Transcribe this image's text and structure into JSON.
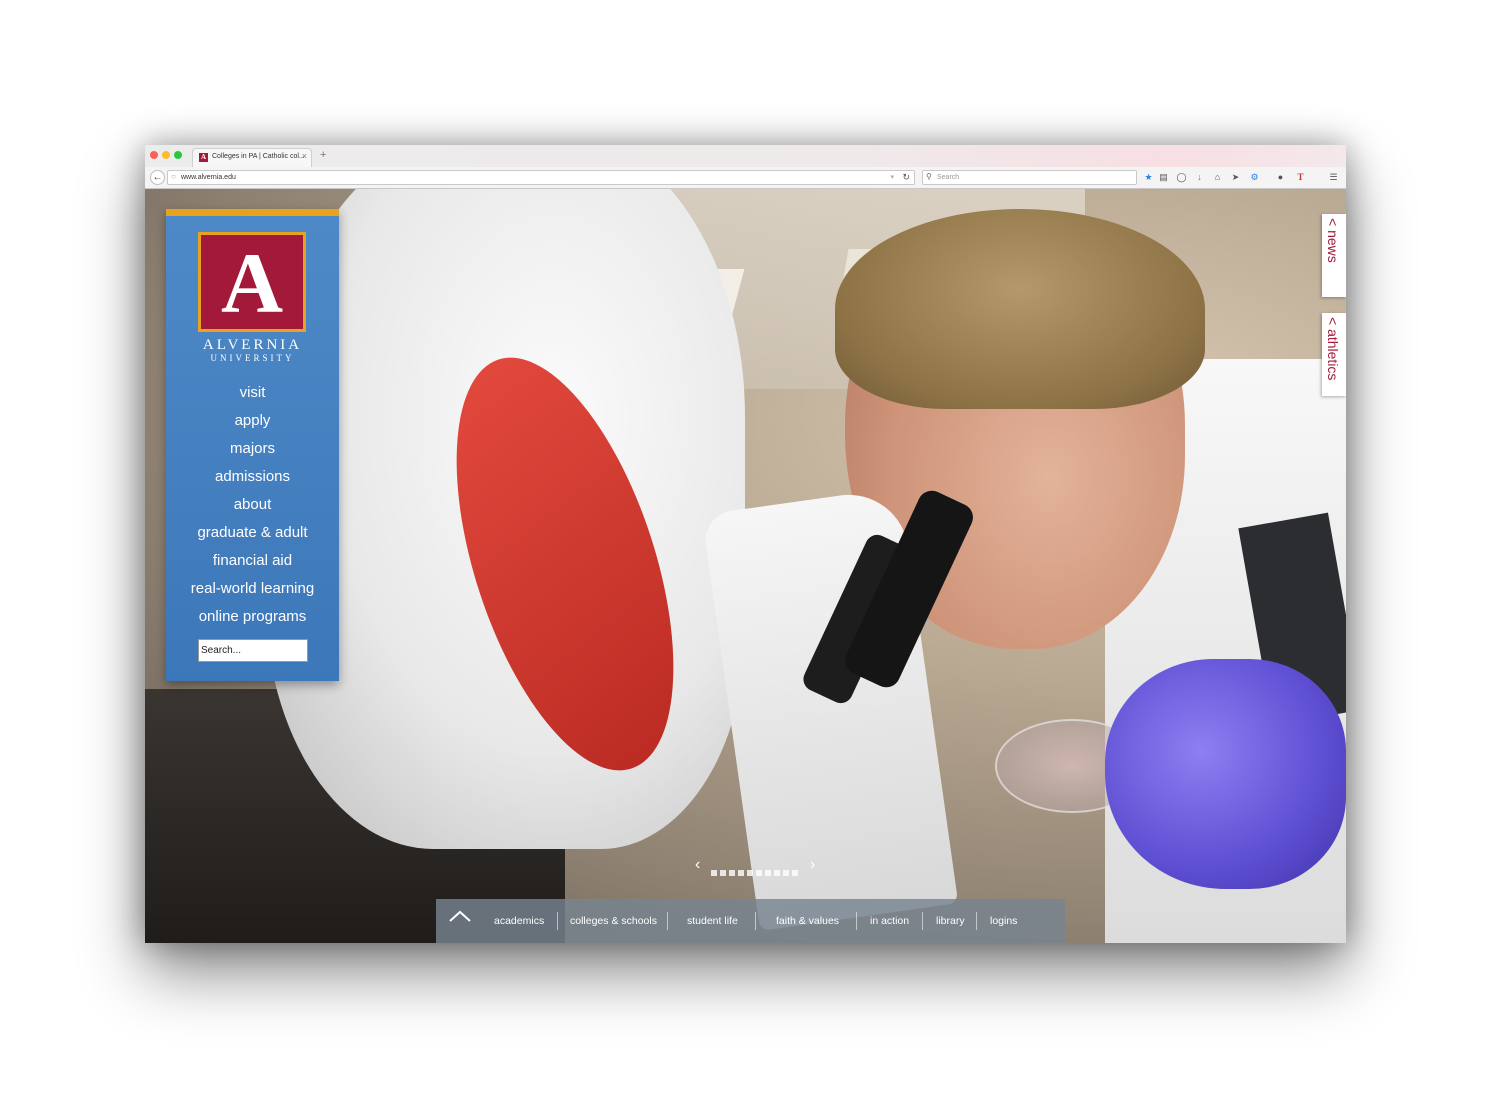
{
  "browser": {
    "tab_title": "Colleges in PA | Catholic col...",
    "tab_favicon": "A",
    "tab_close": "×",
    "new_tab": "+",
    "url": "www.alvernia.edu",
    "search_placeholder": "Search",
    "toolbar_icons": [
      "bookmark-star-icon",
      "clipboard-icon",
      "pocket-icon",
      "download-icon",
      "home-icon",
      "send-icon",
      "addon-icon",
      "chat-icon",
      "text-icon",
      "menu-icon"
    ]
  },
  "logo": {
    "letter": "A",
    "name": "ALVERNIA",
    "sub": "UNIVERSITY"
  },
  "nav": {
    "items": [
      "visit",
      "apply",
      "majors",
      "admissions",
      "about",
      "graduate & adult",
      "financial aid",
      "real-world learning",
      "online programs"
    ],
    "search_placeholder": "Search..."
  },
  "side_tabs": {
    "news": "< news",
    "athletics": "< athletics"
  },
  "slider": {
    "prev": "‹",
    "next": "›",
    "slide_count": 10
  },
  "bottom_bar": {
    "links": [
      "academics",
      "colleges & schools",
      "student life",
      "faith & values",
      "in action",
      "library",
      "logins"
    ]
  },
  "colors": {
    "brand_red": "#a3193a",
    "brand_gold": "#e6a320",
    "nav_blue": "#4e89c7"
  }
}
